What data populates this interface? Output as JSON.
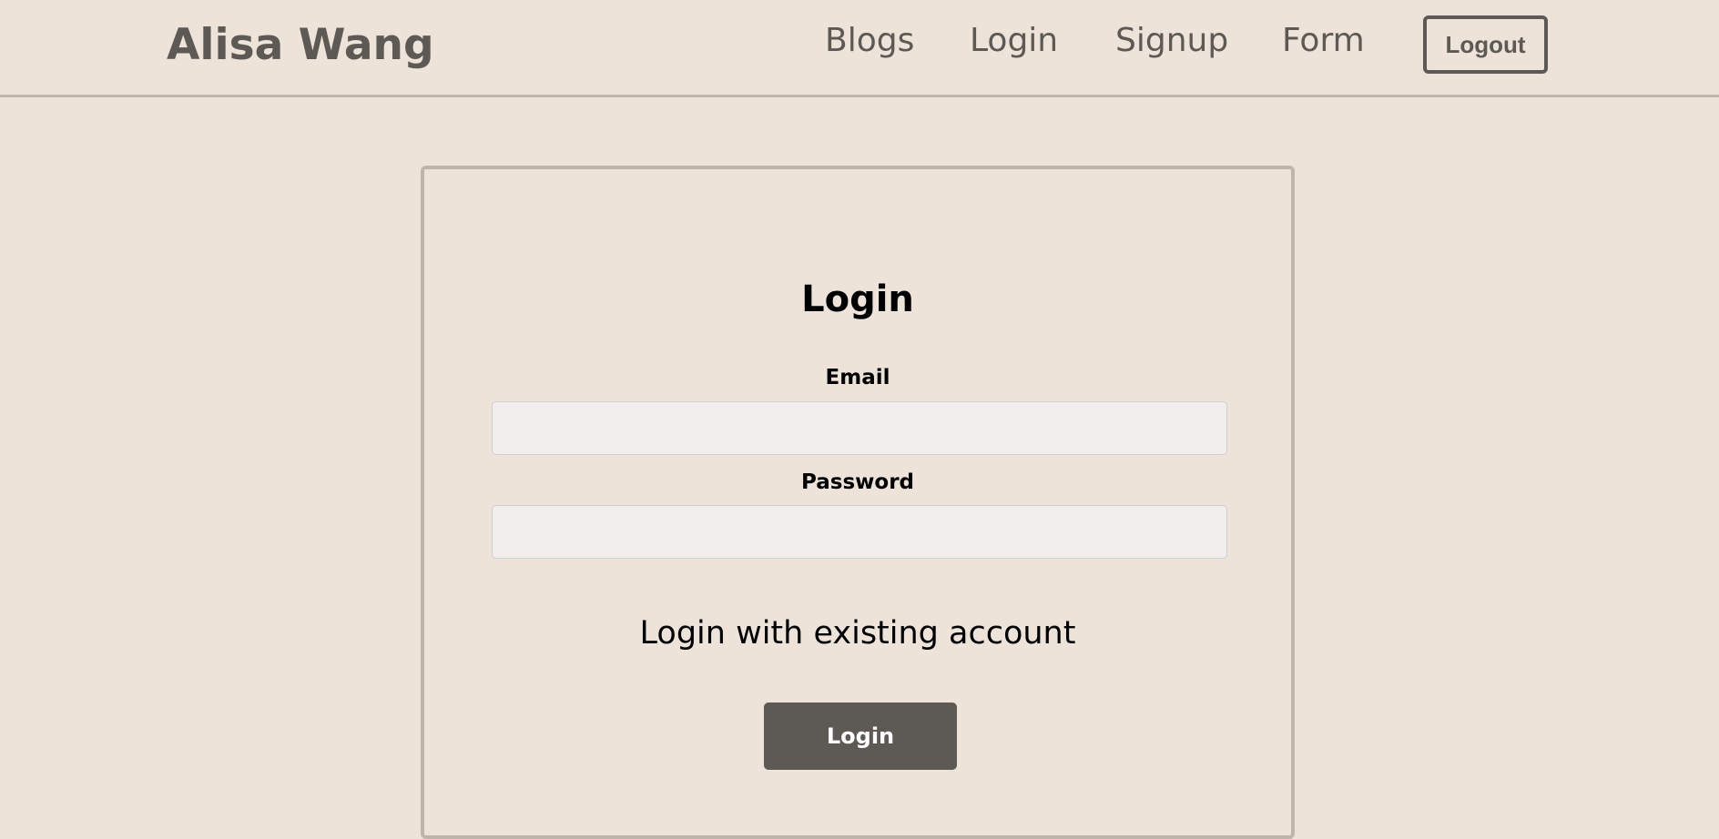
{
  "header": {
    "brand": "Alisa Wang",
    "nav": {
      "blogs": "Blogs",
      "login": "Login",
      "signup": "Signup",
      "form": "Form"
    },
    "logout_label": "Logout"
  },
  "login_form": {
    "title": "Login",
    "email_label": "Email",
    "email_value": "",
    "password_label": "Password",
    "password_value": "",
    "subtitle": "Login with existing account",
    "submit_label": "Login"
  },
  "colors": {
    "background": "#ede3d9",
    "text_muted": "#5d5955",
    "border": "#c0b5ab",
    "input_bg": "#f1eeed",
    "button_bg": "#5d5a55"
  }
}
